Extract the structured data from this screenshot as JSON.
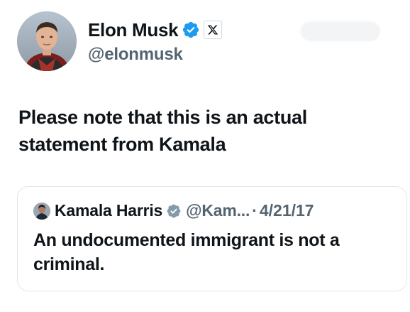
{
  "post": {
    "author": {
      "display_name": "Elon Musk",
      "handle": "@elonmusk",
      "verified_icon": "verified-badge-icon",
      "affiliation_icon": "x-logo-icon",
      "avatar_icon": "profile-photo"
    },
    "text": "Please note that this is an actual statement from Kamala"
  },
  "quoted_post": {
    "author": {
      "display_name": "Kamala Harris",
      "handle": "@Kam...",
      "separator": "·",
      "date": "4/21/17",
      "verified_icon": "gray-verified-badge-icon",
      "avatar_icon": "profile-photo"
    },
    "text": "An undocumented immigrant is not a criminal."
  },
  "colors": {
    "verified_blue": "#1d9bf0",
    "verified_gray": "#829aab",
    "text_primary": "#0f1419",
    "text_secondary": "#536471",
    "border": "#e1e6ea"
  }
}
